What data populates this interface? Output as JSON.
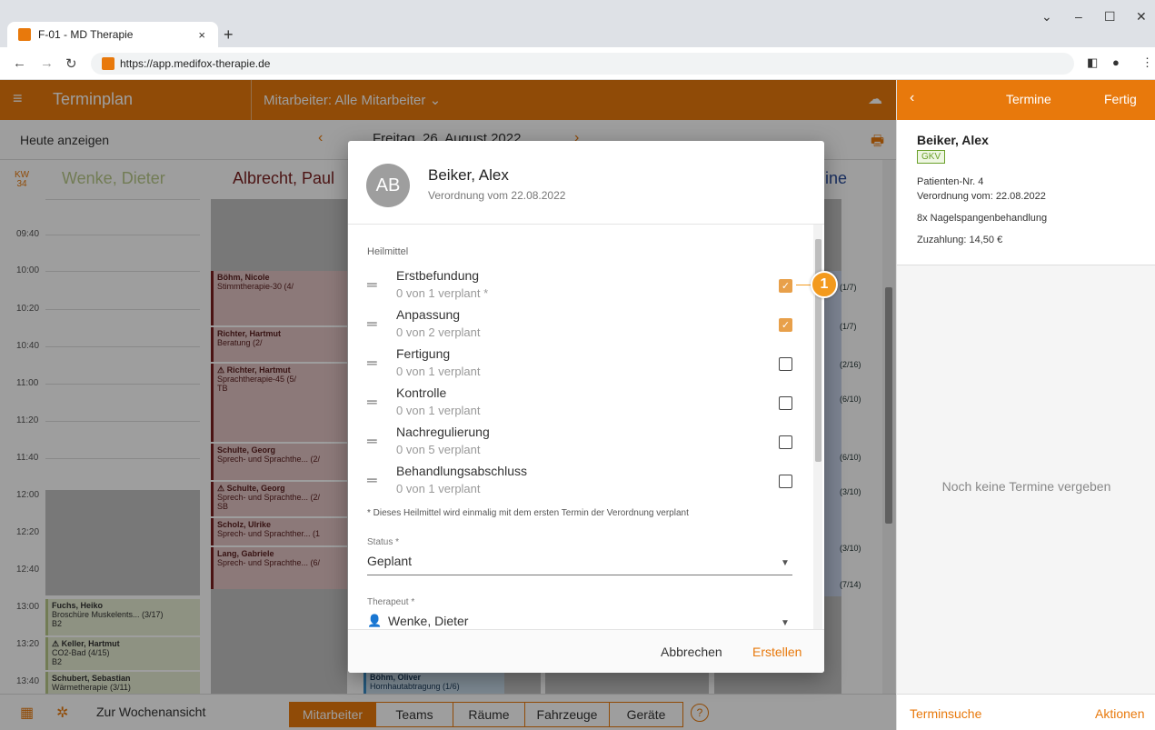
{
  "browser": {
    "tab_title": "F-01 - MD Therapie",
    "tab_close": "×",
    "new_tab": "+",
    "url": "https://app.medifox-therapie.de",
    "window_controls": [
      "⌄",
      "–",
      "☐",
      "✕"
    ]
  },
  "header": {
    "app_title": "Terminplan",
    "employee_filter": "Mitarbeiter: Alle Mitarbeiter ⌄",
    "today_button": "Heute anzeigen",
    "date": "Freitag, 26. August 2022"
  },
  "calendar": {
    "week_label": "KW",
    "week_number": "34",
    "columns": [
      {
        "name": "Wenke, Dieter",
        "color": "#b8c98a"
      },
      {
        "name": "Albrecht, Paul",
        "color": "#7a1f1f"
      },
      {
        "name": "ine",
        "color": "#2a4d9c"
      }
    ],
    "times": [
      "09:40",
      "10:00",
      "10:20",
      "10:40",
      "11:00",
      "11:20",
      "11:40",
      "12:00",
      "12:20",
      "12:40",
      "13:00",
      "13:20",
      "13:40"
    ],
    "appointments_col1": [
      {
        "name": "Fuchs, Heiko",
        "line1": "Broschüre Muskelents... (3/17)",
        "line2": "B2"
      },
      {
        "name": "⚠ Keller, Hartmut",
        "line1": "CO2-Bad (4/15)",
        "line2": "B2"
      },
      {
        "name": "Schubert, Sebastian",
        "line1": "Wärmetherapie (3/11)",
        "line2": ""
      }
    ],
    "appointments_col2": [
      {
        "name": "Böhm, Nicole",
        "line1": "Stimmtherapie-30 (4/",
        "line2": ""
      },
      {
        "name": "Richter, Hartmut",
        "line1": "Beratung (2/",
        "line2": ""
      },
      {
        "name": "⚠ Richter, Hartmut",
        "line1": "Sprachtherapie-45 (5/",
        "line2": "TB"
      },
      {
        "name": "Schulte, Georg",
        "line1": "Sprech- und Sprachthe... (2/",
        "line2": ""
      },
      {
        "name": "⚠ Schulte, Georg",
        "line1": "Sprech- und Sprachthe... (2/",
        "line2": "SB"
      },
      {
        "name": "Scholz, Ulrike",
        "line1": "Sprech- und Sprachther... (1",
        "line2": ""
      },
      {
        "name": "Lang, Gabriele",
        "line1": "Sprech- und Sprachthe... (6/",
        "line2": ""
      }
    ],
    "appointments_col4": [
      "(1/7)",
      "(1/7)",
      "(2/16)",
      "(6/10)",
      "(6/10)",
      "(3/10)",
      "(3/10)",
      "(7/14)"
    ],
    "bottom_appointment": {
      "name": "Böhm, Oliver",
      "line1": "Hornhautabtragung (1/6)"
    }
  },
  "bottom": {
    "week_view": "Zur Wochenansicht",
    "segments": [
      "Mitarbeiter",
      "Teams",
      "Räume",
      "Fahrzeuge",
      "Geräte"
    ],
    "active_segment": "Mitarbeiter",
    "help": "?"
  },
  "right_panel": {
    "title": "Termine",
    "done": "Fertig",
    "patient_name": "Beiker, Alex",
    "insurance": "GKV",
    "patient_number": "Patienten-Nr. 4",
    "prescription_date": "Verordnung vom: 22.08.2022",
    "treatment": "8x Nagelspangenbehandlung",
    "copay": "Zuzahlung: 14,50 €",
    "empty_text": "Noch keine Termine vergeben",
    "search_link": "Terminsuche",
    "actions_link": "Aktionen"
  },
  "dialog": {
    "avatar": "AB",
    "name": "Beiker, Alex",
    "subtitle": "Verordnung vom 22.08.2022",
    "section_label": "Heilmittel",
    "items": [
      {
        "name": "Erstbefundung",
        "sub": "0 von 1 verplant *",
        "checked": true
      },
      {
        "name": "Anpassung",
        "sub": "0 von 2 verplant",
        "checked": true
      },
      {
        "name": "Fertigung",
        "sub": "0 von 1 verplant",
        "checked": false
      },
      {
        "name": "Kontrolle",
        "sub": "0 von 1 verplant",
        "checked": false
      },
      {
        "name": "Nachregulierung",
        "sub": "0 von 5 verplant",
        "checked": false
      },
      {
        "name": "Behandlungsabschluss",
        "sub": "0 von 1 verplant",
        "checked": false
      }
    ],
    "footnote": "* Dieses Heilmittel wird einmalig mit dem ersten Termin der Verordnung verplant",
    "status_label": "Status *",
    "status_value": "Geplant",
    "therapist_label": "Therapeut *",
    "therapist_value": "Wenke, Dieter",
    "cancel": "Abbrechen",
    "create": "Erstellen"
  },
  "callout": "1",
  "colors": {
    "accent": "#e8790c",
    "checkbox": "#e8a04a",
    "gkv": "#6aa02b"
  }
}
